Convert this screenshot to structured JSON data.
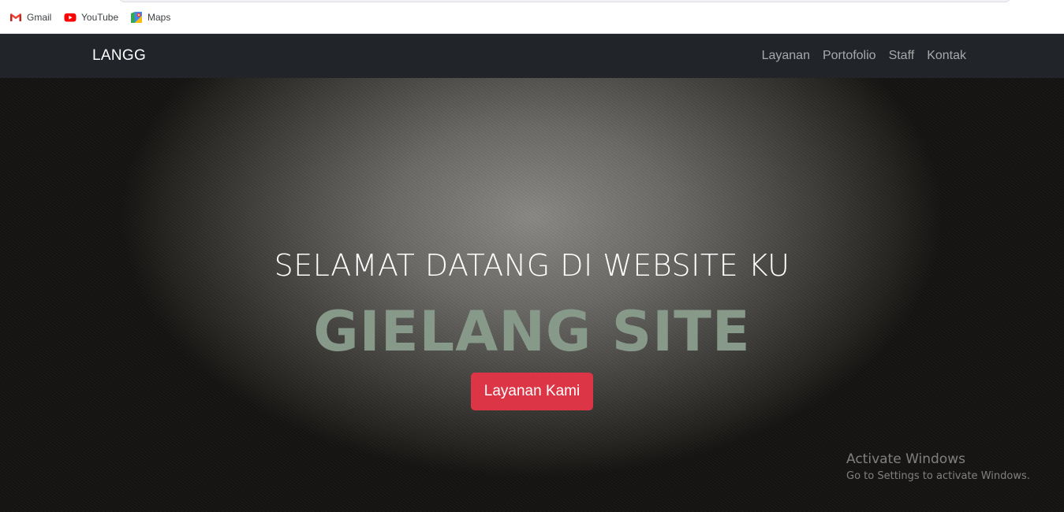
{
  "bookmarks": [
    {
      "label": "Gmail",
      "icon": "gmail-icon"
    },
    {
      "label": "YouTube",
      "icon": "youtube-icon"
    },
    {
      "label": "Maps",
      "icon": "maps-icon"
    }
  ],
  "navbar": {
    "brand": "LANGG",
    "links": [
      "Layanan",
      "Portofolio",
      "Staff",
      "Kontak"
    ],
    "background": "#212529"
  },
  "hero": {
    "subtitle": "SELAMAT DATANG DI WEBSITE KU",
    "title": "GIELANG SITE",
    "button_label": "Layanan Kami",
    "title_color": "#879a8a",
    "button_color": "#dc3545"
  },
  "watermark": {
    "title": "Activate Windows",
    "subtitle": "Go to Settings to activate Windows."
  }
}
